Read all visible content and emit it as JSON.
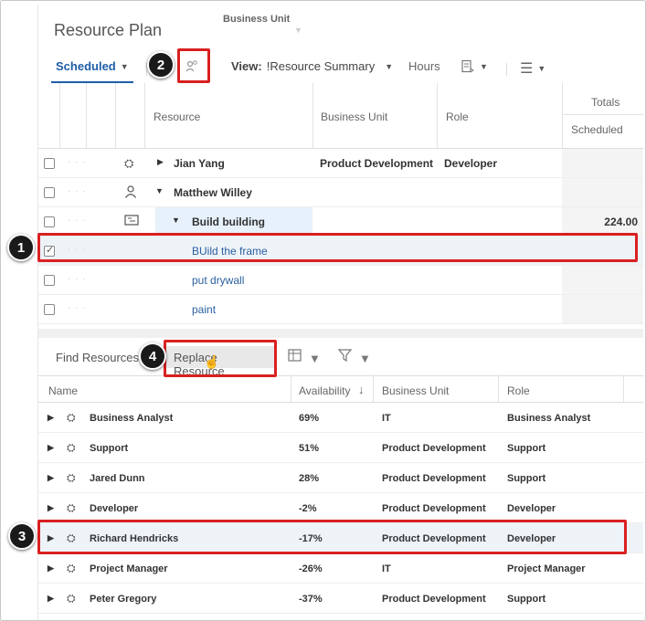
{
  "header": {
    "title": "Resource Plan",
    "business_unit_label": "Business Unit"
  },
  "toolbar": {
    "scheduled_label": "Scheduled",
    "view_prefix": "View:",
    "view_value": "!Resource Summary",
    "hours_label": "Hours",
    "caret": "▼"
  },
  "grid": {
    "col_resource": "Resource",
    "col_business_unit": "Business Unit",
    "col_role": "Role",
    "col_totals": "Totals",
    "col_scheduled": "Scheduled",
    "rows": [
      {
        "name": "Jian Yang",
        "bu": "Product Development",
        "role": "Developer",
        "total": ""
      },
      {
        "name": "Matthew Willey",
        "bu": "",
        "role": "",
        "total": ""
      },
      {
        "name": "Build building",
        "bu": "",
        "role": "",
        "total": "224.00"
      },
      {
        "name": "BUild the frame",
        "bu": "",
        "role": "",
        "total": ""
      },
      {
        "name": "put drywall",
        "bu": "",
        "role": "",
        "total": ""
      },
      {
        "name": "paint",
        "bu": "",
        "role": "",
        "total": ""
      }
    ]
  },
  "find": {
    "tab_find": "Find Resources",
    "tab_replace": "Replace Resource",
    "col_name": "Name",
    "col_availability": "Availability",
    "col_business_unit": "Business Unit",
    "col_role": "Role",
    "rows": [
      {
        "name": "Business Analyst",
        "availability": "69%",
        "bu": "IT",
        "role": "Business Analyst"
      },
      {
        "name": "Support",
        "availability": "51%",
        "bu": "Product Development",
        "role": "Support"
      },
      {
        "name": "Jared Dunn",
        "availability": "28%",
        "bu": "Product Development",
        "role": "Support"
      },
      {
        "name": "Developer",
        "availability": "-2%",
        "bu": "Product Development",
        "role": "Developer"
      },
      {
        "name": "Richard Hendricks",
        "availability": "-17%",
        "bu": "Product Development",
        "role": "Developer"
      },
      {
        "name": "Project Manager",
        "availability": "-26%",
        "bu": "IT",
        "role": "Project Manager"
      },
      {
        "name": "Peter Gregory",
        "availability": "-37%",
        "bu": "Product Development",
        "role": "Support"
      }
    ]
  },
  "annotations": {
    "step1": "1",
    "step2": "2",
    "step3": "3",
    "step4": "4",
    "color": "#d92020"
  }
}
